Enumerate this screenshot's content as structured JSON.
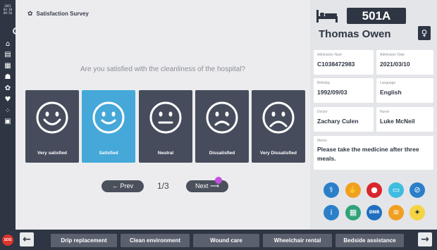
{
  "rail": {
    "clock": [
      "2021",
      "03-10",
      "09:56"
    ],
    "icons": [
      "home-icon",
      "document-icon",
      "calendar-icon",
      "patient-icon",
      "survey-icon",
      "heart-icon",
      "steps-icon",
      "video-icon"
    ],
    "sos_label": "SOS"
  },
  "survey": {
    "title": "Satisfaction Survey",
    "question": "Are you satisfied with the cleanliness of the hospital?",
    "options": [
      {
        "label": "Very satisfied",
        "selected": false
      },
      {
        "label": "Satisfied",
        "selected": true
      },
      {
        "label": "Neutral",
        "selected": false
      },
      {
        "label": "Dissatisfied",
        "selected": false
      },
      {
        "label": "Very Dissatisfied",
        "selected": false
      }
    ],
    "prev_label": "← Prev",
    "page_indicator": "1/3",
    "next_label": "Next ⟶"
  },
  "patient": {
    "room": "501A",
    "name": "Thomas Owen",
    "gender_symbol": "♀",
    "admission_num_label": "Admission Num",
    "admission_num": "C1038472983",
    "admission_date_label": "Admission Date",
    "admission_date": "2021/03/10",
    "birthday_label": "Birthday",
    "birthday": "1992/09/03",
    "language_label": "Language",
    "language": "English",
    "doctor_label": "Doctor",
    "doctor": "Zachary Culen",
    "nurse_label": "Nurse",
    "nurse": "Luke McNeil",
    "memo_label": "Memo",
    "memo": "Please take the medicine after three meals."
  },
  "precautions": [
    {
      "icon": "lungs-icon",
      "color": "#2b7fc9"
    },
    {
      "icon": "allergy-icon",
      "color": "#f0a020"
    },
    {
      "icon": "blood-drop-icon",
      "color": "#d9262c"
    },
    {
      "icon": "mask-icon",
      "color": "#3dbde0"
    },
    {
      "icon": "no-bath-icon",
      "color": "#2b7fc9"
    },
    {
      "icon": "info-icon",
      "color": "#2b7fc9"
    },
    {
      "icon": "fall-risk-icon",
      "color": "#2fa37a"
    },
    {
      "icon": "dnr-icon",
      "color": "#1f6fc0"
    },
    {
      "icon": "diet-icon",
      "color": "#f0a020"
    },
    {
      "icon": "idea-icon",
      "color": "#f4d442"
    }
  ],
  "bottom_bar": {
    "buttons": [
      "Drip replacement",
      "Clean environment",
      "Wound care",
      "Wheelchair rental",
      "Bedside assistance"
    ]
  },
  "colors": {
    "dark": "#2e3543",
    "selected": "#45a8d9",
    "option": "#464c5b"
  }
}
